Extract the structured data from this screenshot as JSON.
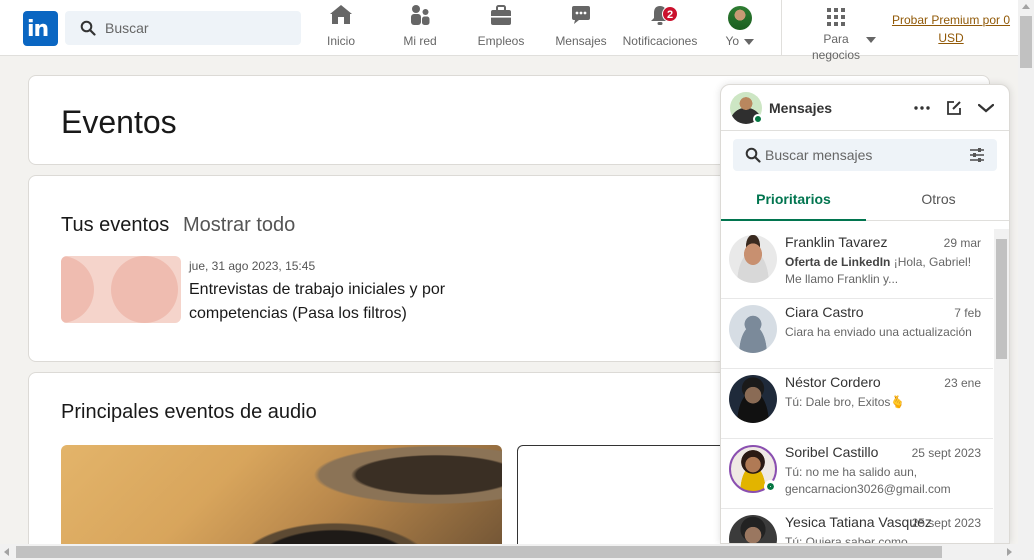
{
  "nav": {
    "logo": "in",
    "search_placeholder": "Buscar",
    "items": [
      {
        "label": "Inicio",
        "icon": "home-icon"
      },
      {
        "label": "Mi red",
        "icon": "network-icon"
      },
      {
        "label": "Empleos",
        "icon": "briefcase-icon"
      },
      {
        "label": "Mensajes",
        "icon": "messaging-icon"
      },
      {
        "label": "Notificaciones",
        "icon": "bell-icon",
        "badge": "2"
      },
      {
        "label": "Yo",
        "icon": "avatar"
      }
    ],
    "business": {
      "label_line1": "Para",
      "label_line2": "negocios",
      "icon": "grid-icon"
    },
    "premium": {
      "line1": "Probar Premium por 0",
      "line2": "USD"
    }
  },
  "events_card": {
    "title": "Eventos"
  },
  "your_events": {
    "title": "Tus eventos",
    "show_all": "Mostrar todo",
    "event": {
      "date": "jue, 31 ago 2023, 15:45",
      "title": "Entrevistas de trabajo iniciales y por competencias (Pasa los filtros)"
    }
  },
  "audio_events": {
    "title": "Principales eventos de audio"
  },
  "messaging": {
    "title": "Mensajes",
    "search_placeholder": "Buscar mensajes",
    "tabs": [
      {
        "label": "Prioritarios",
        "active": true
      },
      {
        "label": "Otros",
        "active": false
      }
    ],
    "conversations": [
      {
        "name": "Franklin Tavarez",
        "date": "29 mar",
        "preview_bold": "Oferta de LinkedIn",
        "preview": " ¡Hola, Gabriel! Me llamo Franklin y..."
      },
      {
        "name": "Ciara Castro",
        "date": "7 feb",
        "preview_bold": "",
        "preview": "Ciara ha enviado una actualización"
      },
      {
        "name": "Néstor Cordero",
        "date": "23 ene",
        "preview_bold": "",
        "preview": "Tú: Dale bro, Exitos🫰"
      },
      {
        "name": "Soribel Castillo",
        "date": "25 sept 2023",
        "preview_bold": "",
        "preview": "Tú: no me ha salido aun, gencarnacion3026@gmail.com"
      },
      {
        "name": "Yesica Tatiana Vasquez",
        "date": "25 sept 2023",
        "preview_bold": "",
        "preview": "Tú: Quiera saber como..."
      }
    ]
  },
  "colors": {
    "brand": "#0a66c2",
    "accent_green": "#01754f",
    "badge_red": "#cb112d",
    "premium_gold": "#915907"
  }
}
